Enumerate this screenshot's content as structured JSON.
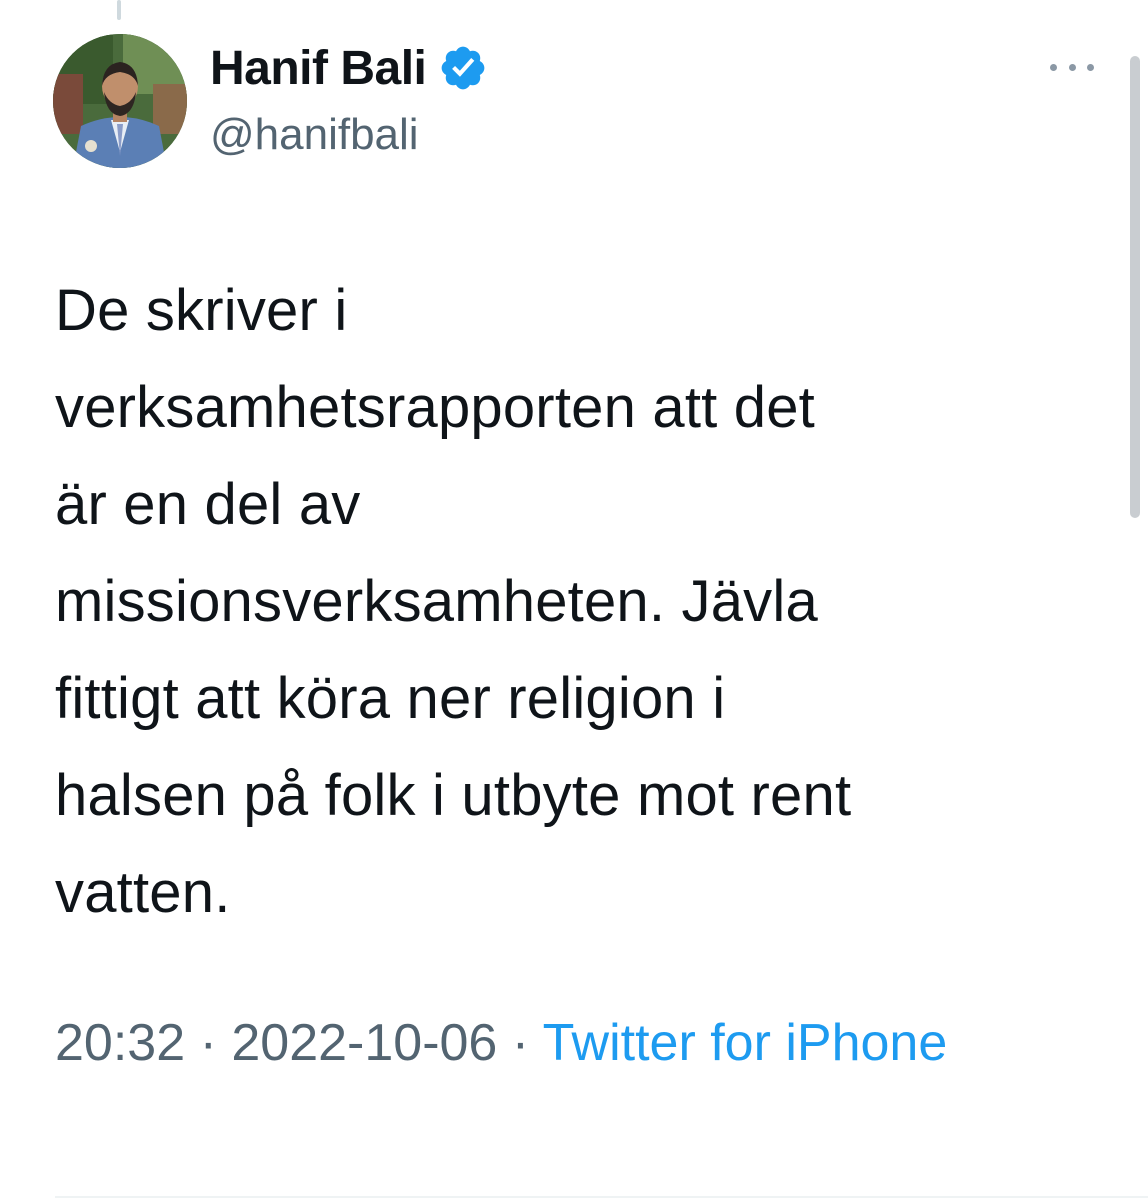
{
  "author": {
    "display_name": "Hanif Bali",
    "handle": "@hanifbali",
    "verified": true,
    "avatar_icon": "profile-photo"
  },
  "tweet": {
    "text": "De skriver i\nverksamhetsrapporten att det\när en del av\nmissionsverksamheten. Jävla\nfittigt att köra ner religion i\nhalsen på folk i utbyte mot rent\nvatten."
  },
  "meta": {
    "time": "20:32",
    "separator": " · ",
    "date": "2022-10-06",
    "source": "Twitter for iPhone"
  },
  "icons": {
    "verified": "verified-badge-icon",
    "more": "more-options-icon"
  },
  "colors": {
    "accent": "#1d9bf0",
    "secondary_text": "#536471",
    "primary_text": "#0f1419"
  }
}
